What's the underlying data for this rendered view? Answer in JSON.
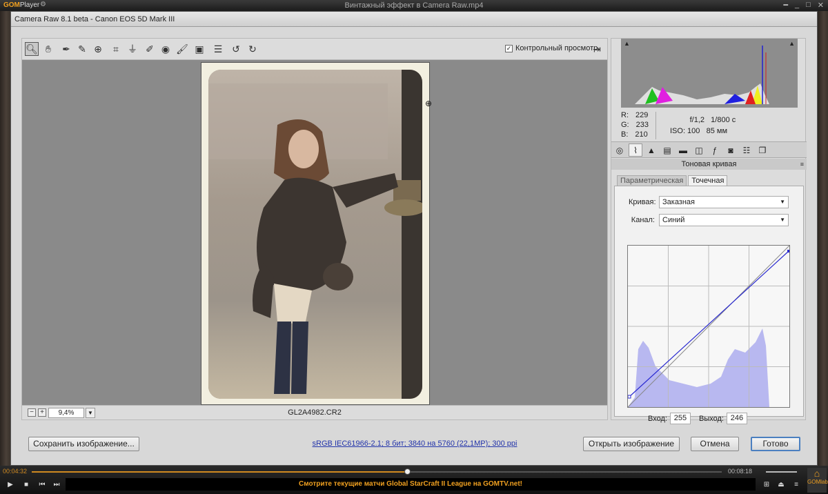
{
  "player": {
    "logo": "GOM",
    "logo_sub": "Player",
    "title": "Винтажный эффект в Camera Raw.mp4",
    "time_elapsed": "00:04:32",
    "time_total": "00:08:18",
    "progress": 0.545,
    "ticker": "Смотрите текущие матчи Global StarCraft II League на GOMTV.net!",
    "gomlab": "GOMlab"
  },
  "window": {
    "title": "Camera Raw 8.1 beta  -  Canon EOS 5D Mark III"
  },
  "toolbar": {
    "tools": [
      "zoom-icon",
      "hand-icon",
      "white-balance-icon",
      "color-sampler-icon",
      "target-adjust-icon",
      "crop-icon",
      "straighten-icon",
      "spot-removal-icon",
      "red-eye-icon",
      "adjustment-brush-icon",
      "graduated-filter-icon",
      "radial-filter-icon",
      "preferences-icon",
      "rotate-left-icon",
      "rotate-right-icon"
    ],
    "preview_label": "Контрольный просмотр",
    "preview_checked": true
  },
  "status": {
    "zoom": "9,4%",
    "filename": "GL2A4982.CR2"
  },
  "readout": {
    "r": "229",
    "g": "233",
    "b": "210",
    "r_label": "R:",
    "g_label": "G:",
    "b_label": "B:",
    "aperture": "f/1,2",
    "shutter": "1/800 с",
    "iso": "ISO: 100",
    "focal": "85 мм"
  },
  "panel": {
    "header": "Тоновая кривая",
    "tab_parametric": "Параметрическая",
    "tab_point": "Точечная",
    "curve_label": "Кривая:",
    "curve_value": "Заказная",
    "channel_label": "Канал:",
    "channel_value": "Синий",
    "input_label": "Вход:",
    "input_value": "255",
    "output_label": "Выход:",
    "output_value": "246"
  },
  "buttons": {
    "save": "Сохранить изображение...",
    "open": "Открыть изображение",
    "cancel": "Отмена",
    "done": "Готово"
  },
  "workflow_info": "sRGB IEC61966-2.1; 8 бит; 3840 на 5760 (22,1MP); 300 ppi",
  "colors": {
    "accent": "#f0a020",
    "curve": "#2a2ad0",
    "hist_blue": "#b8b8f0"
  }
}
